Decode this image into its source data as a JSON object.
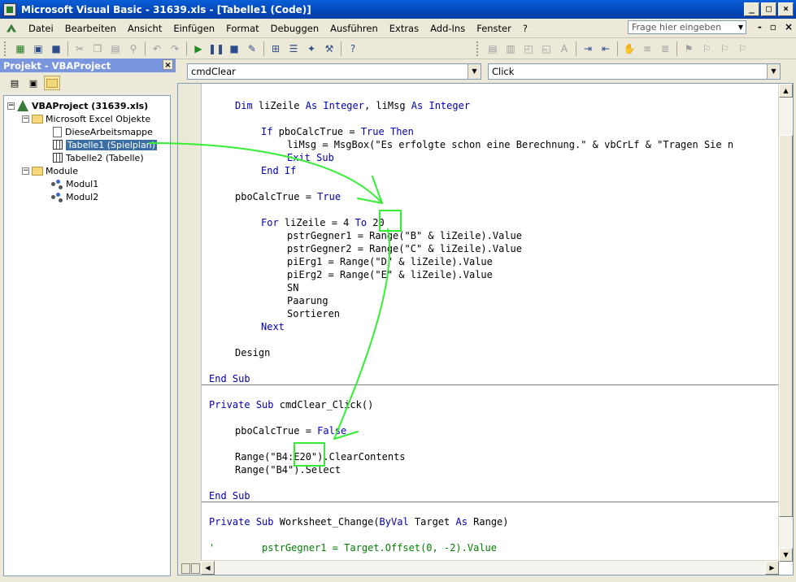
{
  "window": {
    "title": "Microsoft Visual Basic - 31639.xls - [Tabelle1 (Code)]"
  },
  "menu": {
    "items": [
      "Datei",
      "Bearbeiten",
      "Ansicht",
      "Einfügen",
      "Format",
      "Debuggen",
      "Ausführen",
      "Extras",
      "Add-Ins",
      "Fenster",
      "?"
    ],
    "ask_placeholder": "Frage hier eingeben"
  },
  "project": {
    "title": "Projekt - VBAProject",
    "tree": {
      "root": "VBAProject (31639.xls)",
      "folder_objects": "Microsoft Excel Objekte",
      "item_workbook": "DieseArbeitsmappe",
      "item_sheet1": "Tabelle1 (Spielplan)",
      "item_sheet2": "Tabelle2 (Tabelle)",
      "folder_modules": "Module",
      "item_module1": "Modul1",
      "item_module2": "Modul2"
    }
  },
  "editor": {
    "object_combo": "cmdClear",
    "proc_combo": "Click",
    "code": {
      "l1a": "Dim",
      "l1b": " liZeile ",
      "l1c": "As",
      "l1d": " ",
      "l1e": "Integer",
      "l1f": ", liMsg ",
      "l1g": "As",
      "l1h": " ",
      "l1i": "Integer",
      "l2a": "If",
      "l2b": " pboCalcTrue = ",
      "l2c": "True",
      "l2d": " ",
      "l2e": "Then",
      "l3": "liMsg = MsgBox(\"Es erfolgte schon eine Berechnung.\" & vbCrLf & \"Tragen Sie n",
      "l4a": "Exit",
      "l4b": " ",
      "l4c": "Sub",
      "l5a": "End",
      "l5b": " ",
      "l5c": "If",
      "l6a": "pboCalcTrue = ",
      "l6b": "True",
      "l7a": "For",
      "l7b": " liZeile = 4 ",
      "l7c": "To",
      "l7d": " 20",
      "l8": "pstrGegner1 = Range(\"B\" & liZeile).Value",
      "l9": "pstrGegner2 = Range(\"C\" & liZeile).Value",
      "l10": "piErg1 = Range(\"D\" & liZeile).Value",
      "l11": "piErg2 = Range(\"E\" & liZeile).Value",
      "l12": "SN",
      "l13": "Paarung",
      "l14": "Sortieren",
      "l15": "Next",
      "l16": "Design",
      "l17a": "End",
      "l17b": " ",
      "l17c": "Sub",
      "l18a": "Private",
      "l18b": " ",
      "l18c": "Sub",
      "l18d": " cmdClear_Click()",
      "l19a": "pboCalcTrue = ",
      "l19b": "False",
      "l20": "Range(\"B4:E20\").ClearContents",
      "l21": "Range(\"B4\").Select",
      "l22a": "End",
      "l22b": " ",
      "l22c": "Sub",
      "l23a": "Private",
      "l23b": " ",
      "l23c": "Sub",
      "l23d": " Worksheet_Change(",
      "l23e": "ByVal",
      "l23f": " Target ",
      "l23g": "As",
      "l23h": " Range)",
      "l24": "'        pstrGegner1 = Target.Offset(0, -2).Value"
    }
  },
  "colors": {
    "keyword": "#0000b0",
    "comment": "#008000",
    "annotation": "#33ee33",
    "selection": "#3a6ea5"
  }
}
